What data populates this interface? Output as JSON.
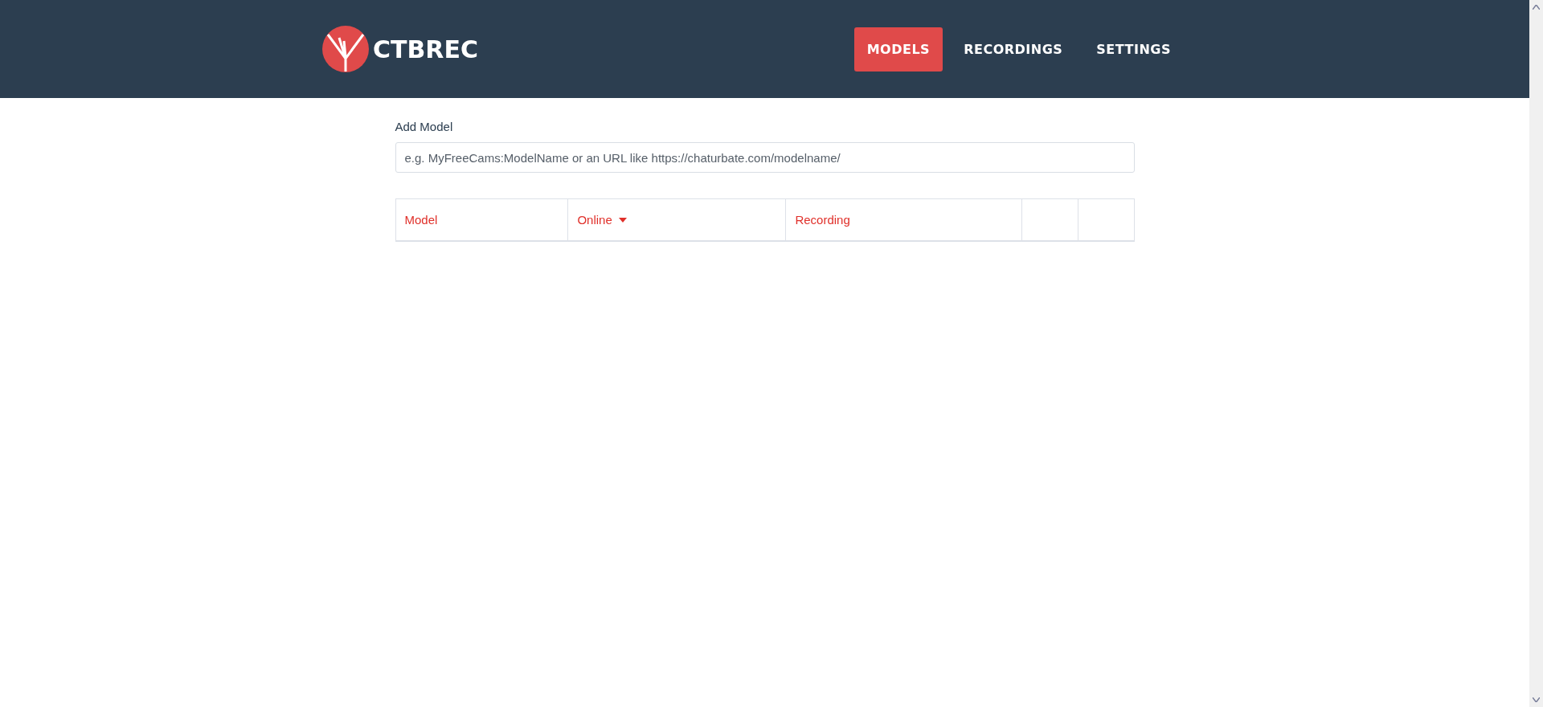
{
  "brand": {
    "name": "CTBREC"
  },
  "nav": [
    {
      "label": "MODELS",
      "selected": true
    },
    {
      "label": "RECORDINGS",
      "selected": false
    },
    {
      "label": "SETTINGS",
      "selected": false
    }
  ],
  "add_model": {
    "label": "Add Model",
    "placeholder": "e.g. MyFreeCams:ModelName or an URL like https://chaturbate.com/modelname/"
  },
  "table": {
    "columns": [
      {
        "label": "Model",
        "sorted": false
      },
      {
        "label": "Online",
        "sorted": true
      },
      {
        "label": "Recording",
        "sorted": false
      }
    ]
  }
}
